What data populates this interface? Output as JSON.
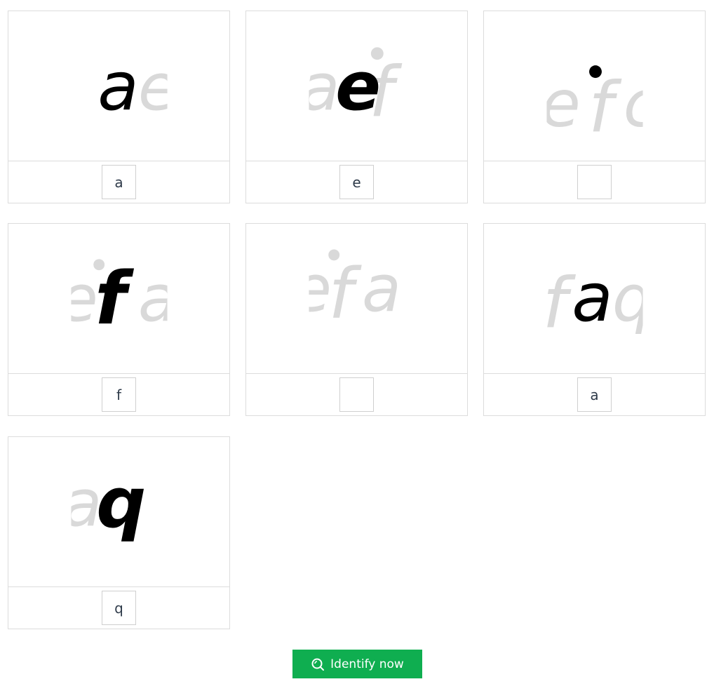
{
  "cards": [
    {
      "ghost": "ae",
      "ink": "a",
      "answer": "a"
    },
    {
      "ghost": "aef",
      "ink": "e",
      "answer": "e"
    },
    {
      "ghost": "aefc",
      "ink": "",
      "answer": ""
    },
    {
      "ghost": "efa",
      "ink": "f",
      "answer": "f"
    },
    {
      "ghost": "efa",
      "ink": "",
      "answer": ""
    },
    {
      "ghost": "faq",
      "ink": "a",
      "answer": "a"
    },
    {
      "ghost": "aq",
      "ink": "q",
      "answer": "q"
    }
  ],
  "button": {
    "label": "Identify now",
    "icon": "search-icon",
    "color": "#0fae50"
  }
}
